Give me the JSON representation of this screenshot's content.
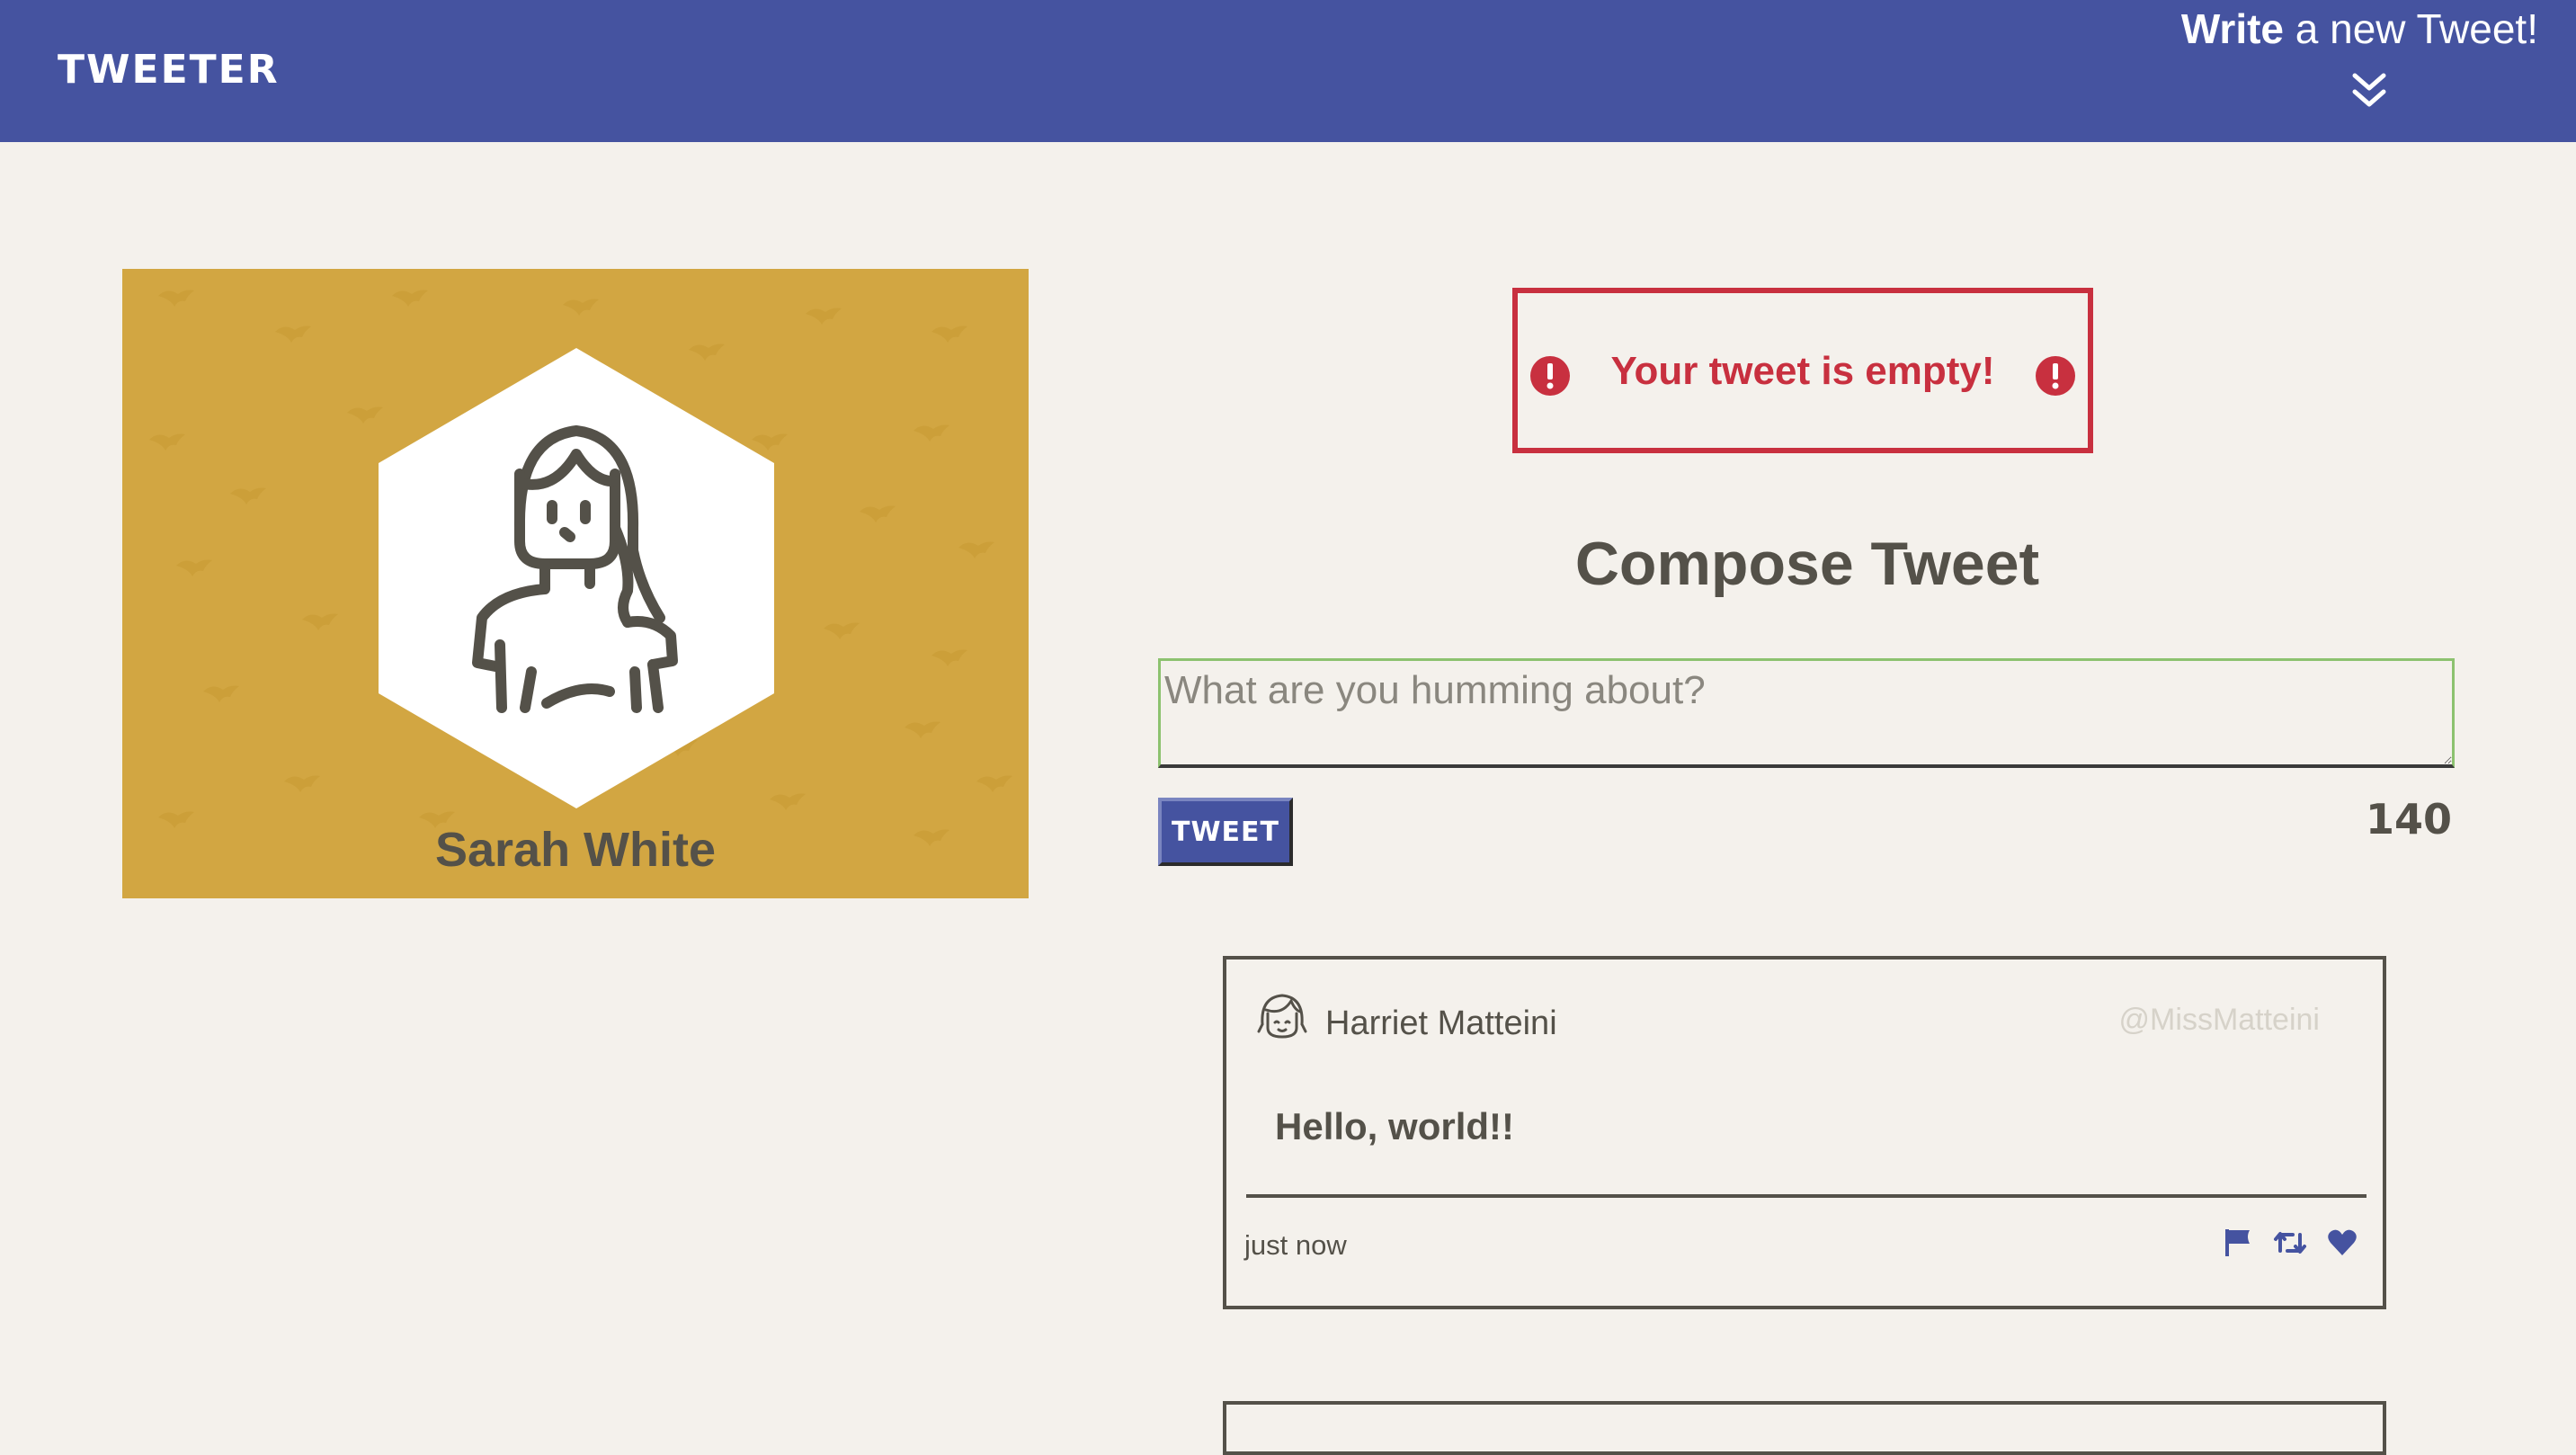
{
  "header": {
    "brand": "TWEETER",
    "write_strong": "Write",
    "write_rest": " a new Tweet!",
    "chevron_icon": "double-chevron-down-icon"
  },
  "profile": {
    "name": "Sarah White",
    "background_color": "#d2a642",
    "avatar_icon": "woman-avatar-icon"
  },
  "error": {
    "message": "Your tweet is empty!",
    "icon": "exclamation-circle-icon",
    "color": "#c8303f"
  },
  "compose": {
    "title": "Compose Tweet",
    "placeholder": "What are you humming about?",
    "value": "",
    "submit_label": "TWEET",
    "counter": "140"
  },
  "tweets": [
    {
      "author": "Harriet Matteini",
      "handle": "@MissMatteini",
      "body": "Hello, world!!",
      "timestamp": "just now",
      "actions": [
        "flag-icon",
        "retweet-icon",
        "heart-icon"
      ]
    }
  ],
  "colors": {
    "header": "#4553a0",
    "page_bg": "#f4f1ec",
    "text": "#545149",
    "input_focus": "#8cc26f"
  }
}
